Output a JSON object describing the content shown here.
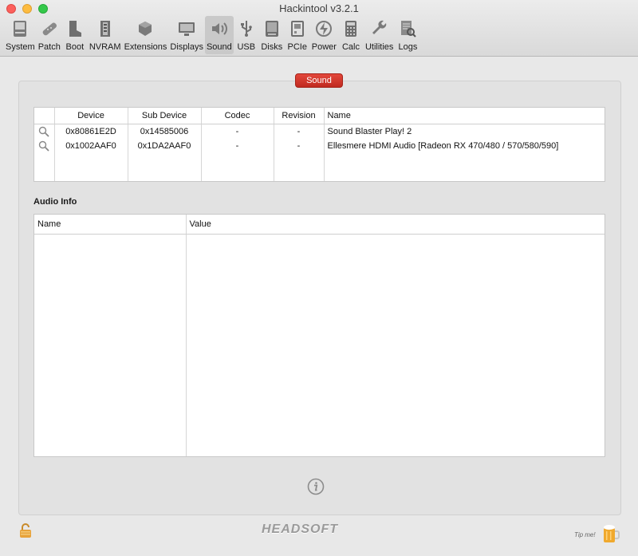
{
  "window": {
    "title": "Hackintool v3.2.1"
  },
  "toolbar": {
    "items": [
      {
        "label": "System",
        "icon": "system-icon"
      },
      {
        "label": "Patch",
        "icon": "patch-icon"
      },
      {
        "label": "Boot",
        "icon": "boot-icon"
      },
      {
        "label": "NVRAM",
        "icon": "nvram-icon"
      },
      {
        "label": "Extensions",
        "icon": "extensions-icon"
      },
      {
        "label": "Displays",
        "icon": "displays-icon"
      },
      {
        "label": "Sound",
        "icon": "sound-icon",
        "active": true
      },
      {
        "label": "USB",
        "icon": "usb-icon"
      },
      {
        "label": "Disks",
        "icon": "disks-icon"
      },
      {
        "label": "PCIe",
        "icon": "pcie-icon"
      },
      {
        "label": "Power",
        "icon": "power-icon"
      },
      {
        "label": "Calc",
        "icon": "calc-icon"
      },
      {
        "label": "Utilities",
        "icon": "utilities-icon"
      },
      {
        "label": "Logs",
        "icon": "logs-icon"
      }
    ]
  },
  "section": {
    "tab_label": "Sound"
  },
  "device_table": {
    "columns": [
      "",
      "Device",
      "Sub Device",
      "Codec",
      "Revision",
      "Name"
    ],
    "rows": [
      {
        "device": "0x80861E2D",
        "sub_device": "0x14585006",
        "codec": "-",
        "revision": "-",
        "name": "Sound Blaster Play! 2"
      },
      {
        "device": "0x1002AAF0",
        "sub_device": "0x1DA2AAF0",
        "codec": "-",
        "revision": "-",
        "name": "Ellesmere HDMI Audio [Radeon RX 470/480 / 570/580/590]"
      }
    ]
  },
  "audio_info": {
    "title": "Audio Info",
    "columns": [
      "Name",
      "Value"
    ]
  },
  "footer": {
    "brand": "HEADSOFT",
    "tip_label": "Tip me!"
  },
  "colors": {
    "accent_red": "#d4372c",
    "panel_bg": "#e2e2e2"
  }
}
